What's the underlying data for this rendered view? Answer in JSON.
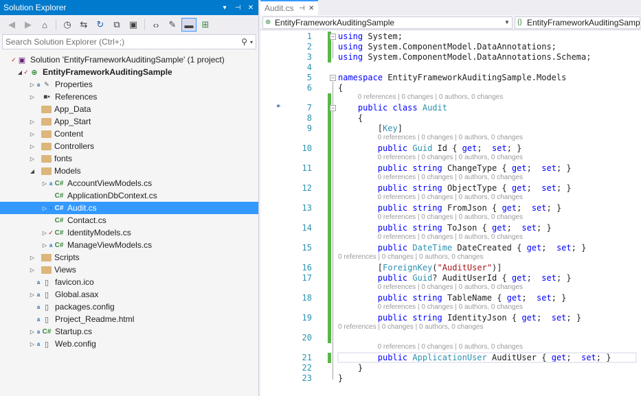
{
  "solution_explorer": {
    "title": "Solution Explorer",
    "title_buttons": [
      "▾",
      "⊣",
      "✕"
    ],
    "search_placeholder": "Search Solution Explorer (Ctrl+;)",
    "tree": [
      {
        "label": "Solution 'EntityFrameworkAuditingSample' (1 project)",
        "indent": 0,
        "arrow": "",
        "state": "check",
        "icon": "sln",
        "bold": false,
        "selected": false
      },
      {
        "label": "EntityFrameworkAuditingSample",
        "indent": 1,
        "arrow": "▲",
        "state": "check",
        "icon": "globe",
        "bold": true,
        "selected": false
      },
      {
        "label": "Properties",
        "indent": 2,
        "arrow": "▷",
        "state": "lock",
        "icon": "wrench",
        "bold": false,
        "selected": false
      },
      {
        "label": "References",
        "indent": 2,
        "arrow": "▷",
        "state": "",
        "icon": "ref",
        "bold": false,
        "selected": false
      },
      {
        "label": "App_Data",
        "indent": 2,
        "arrow": "",
        "state": "",
        "icon": "folder",
        "bold": false,
        "selected": false
      },
      {
        "label": "App_Start",
        "indent": 2,
        "arrow": "▷",
        "state": "",
        "icon": "folder",
        "bold": false,
        "selected": false
      },
      {
        "label": "Content",
        "indent": 2,
        "arrow": "▷",
        "state": "",
        "icon": "folder",
        "bold": false,
        "selected": false
      },
      {
        "label": "Controllers",
        "indent": 2,
        "arrow": "▷",
        "state": "",
        "icon": "folder",
        "bold": false,
        "selected": false
      },
      {
        "label": "fonts",
        "indent": 2,
        "arrow": "▷",
        "state": "",
        "icon": "folder",
        "bold": false,
        "selected": false
      },
      {
        "label": "Models",
        "indent": 2,
        "arrow": "▲",
        "state": "",
        "icon": "folder",
        "bold": false,
        "selected": false
      },
      {
        "label": "AccountViewModels.cs",
        "indent": 3,
        "arrow": "▷",
        "state": "lock",
        "icon": "cs",
        "bold": false,
        "selected": false
      },
      {
        "label": "ApplicationDbContext.cs",
        "indent": 3,
        "arrow": "",
        "state": "",
        "icon": "cs",
        "bold": false,
        "selected": false
      },
      {
        "label": "Audit.cs",
        "indent": 3,
        "arrow": "▷",
        "state": "plus",
        "icon": "cs",
        "bold": false,
        "selected": true
      },
      {
        "label": "Contact.cs",
        "indent": 3,
        "arrow": "",
        "state": "",
        "icon": "cs",
        "bold": false,
        "selected": false
      },
      {
        "label": "IdentityModels.cs",
        "indent": 3,
        "arrow": "▷",
        "state": "check",
        "icon": "cs",
        "bold": false,
        "selected": false
      },
      {
        "label": "ManageViewModels.cs",
        "indent": 3,
        "arrow": "▷",
        "state": "lock",
        "icon": "cs",
        "bold": false,
        "selected": false
      },
      {
        "label": "Scripts",
        "indent": 2,
        "arrow": "▷",
        "state": "",
        "icon": "folder",
        "bold": false,
        "selected": false
      },
      {
        "label": "Views",
        "indent": 2,
        "arrow": "▷",
        "state": "",
        "icon": "folder",
        "bold": false,
        "selected": false
      },
      {
        "label": "favicon.ico",
        "indent": 2,
        "arrow": "",
        "state": "lock",
        "icon": "file",
        "bold": false,
        "selected": false
      },
      {
        "label": "Global.asax",
        "indent": 2,
        "arrow": "▷",
        "state": "lock",
        "icon": "file",
        "bold": false,
        "selected": false
      },
      {
        "label": "packages.config",
        "indent": 2,
        "arrow": "",
        "state": "lock",
        "icon": "file",
        "bold": false,
        "selected": false
      },
      {
        "label": "Project_Readme.html",
        "indent": 2,
        "arrow": "",
        "state": "lock",
        "icon": "file",
        "bold": false,
        "selected": false
      },
      {
        "label": "Startup.cs",
        "indent": 2,
        "arrow": "▷",
        "state": "lock",
        "icon": "cs",
        "bold": false,
        "selected": false
      },
      {
        "label": "Web.config",
        "indent": 2,
        "arrow": "▷",
        "state": "lock",
        "icon": "file",
        "bold": false,
        "selected": false
      }
    ]
  },
  "editor": {
    "tab": {
      "label": "Audit.cs",
      "pin": "⊣",
      "close": "✕"
    },
    "nav": {
      "project": "EntityFrameworkAuditingSample",
      "type": "EntityFrameworkAuditingSample"
    },
    "lines": [
      {
        "n": "1",
        "lens": "",
        "tokens": [
          [
            "kw",
            "using"
          ],
          [
            "",
            "System;"
          ]
        ]
      },
      {
        "n": "2",
        "lens": "",
        "tokens": [
          [
            "kw",
            "using"
          ],
          [
            "",
            "System.ComponentModel.DataAnnotations;"
          ]
        ]
      },
      {
        "n": "3",
        "lens": "",
        "tokens": [
          [
            "kw",
            "using"
          ],
          [
            "",
            "System.ComponentModel.DataAnnotations.Schema;"
          ]
        ]
      },
      {
        "n": "4",
        "lens": "",
        "tokens": []
      },
      {
        "n": "5",
        "lens": "",
        "tokens": [
          [
            "kw",
            "namespace"
          ],
          [
            "",
            "EntityFrameworkAuditingSample.Models"
          ]
        ]
      },
      {
        "n": "6",
        "lens": "",
        "tokens": [
          [
            "",
            "{"
          ]
        ]
      },
      {
        "n": "7",
        "lens": "0 references | 0 changes | 0 authors, 0 changes",
        "tokens": [
          [
            "",
            "    "
          ],
          [
            "kw",
            "public class"
          ],
          [
            "ty",
            "Audit"
          ]
        ]
      },
      {
        "n": "8",
        "lens": "",
        "tokens": [
          [
            "",
            "    {"
          ]
        ]
      },
      {
        "n": "9",
        "lens": "",
        "tokens": [
          [
            "",
            "        ["
          ],
          [
            "ty",
            "Key"
          ],
          [
            "",
            "]"
          ]
        ]
      },
      {
        "n": "10",
        "lens": "0 references | 0 changes | 0 authors, 0 changes",
        "tokens": [
          [
            "",
            "        "
          ],
          [
            "kw",
            "public"
          ],
          [
            "ty",
            "Guid"
          ],
          [
            "",
            "Id {"
          ],
          [
            "kw",
            "get"
          ],
          [
            "",
            "; "
          ],
          [
            "kw",
            "set"
          ],
          [
            "",
            "; }"
          ]
        ]
      },
      {
        "n": "11",
        "lens": "0 references | 0 changes | 0 authors, 0 changes",
        "tokens": [
          [
            "",
            "        "
          ],
          [
            "kw",
            "public string"
          ],
          [
            "",
            "ChangeType {"
          ],
          [
            "kw",
            "get"
          ],
          [
            "",
            "; "
          ],
          [
            "kw",
            "set"
          ],
          [
            "",
            "; }"
          ]
        ]
      },
      {
        "n": "12",
        "lens": "0 references | 0 changes | 0 authors, 0 changes",
        "tokens": [
          [
            "",
            "        "
          ],
          [
            "kw",
            "public string"
          ],
          [
            "",
            "ObjectType {"
          ],
          [
            "kw",
            "get"
          ],
          [
            "",
            "; "
          ],
          [
            "kw",
            "set"
          ],
          [
            "",
            "; }"
          ]
        ]
      },
      {
        "n": "13",
        "lens": "0 references | 0 changes | 0 authors, 0 changes",
        "tokens": [
          [
            "",
            "        "
          ],
          [
            "kw",
            "public string"
          ],
          [
            "",
            "FromJson {"
          ],
          [
            "kw",
            "get"
          ],
          [
            "",
            "; "
          ],
          [
            "kw",
            "set"
          ],
          [
            "",
            "; }"
          ]
        ]
      },
      {
        "n": "14",
        "lens": "0 references | 0 changes | 0 authors, 0 changes",
        "tokens": [
          [
            "",
            "        "
          ],
          [
            "kw",
            "public string"
          ],
          [
            "",
            "ToJson {"
          ],
          [
            "kw",
            "get"
          ],
          [
            "",
            "; "
          ],
          [
            "kw",
            "set"
          ],
          [
            "",
            "; }"
          ]
        ]
      },
      {
        "n": "15",
        "lens": "0 references | 0 changes | 0 authors, 0 changes",
        "tokens": [
          [
            "",
            "        "
          ],
          [
            "kw",
            "public"
          ],
          [
            "ty",
            "DateTime"
          ],
          [
            "",
            "DateCreated {"
          ],
          [
            "kw",
            "get"
          ],
          [
            "",
            "; "
          ],
          [
            "kw",
            "set"
          ],
          [
            "",
            "; }"
          ]
        ]
      },
      {
        "n": "16",
        "lens": "0 references | 0 changes | 0 authors, 0 changes",
        "tokens": [
          [
            "",
            "        ["
          ],
          [
            "ty",
            "ForeignKey"
          ],
          [
            "",
            "("
          ],
          [
            "st",
            "\"AuditUser\""
          ],
          [
            "",
            ")]"
          ]
        ]
      },
      {
        "n": "17",
        "lens": "",
        "tokens": [
          [
            "",
            "        "
          ],
          [
            "kw",
            "public"
          ],
          [
            "ty",
            "Guid"
          ],
          [
            "",
            "? AuditUserId {"
          ],
          [
            "kw",
            "get"
          ],
          [
            "",
            "; "
          ],
          [
            "kw",
            "set"
          ],
          [
            "",
            "; }"
          ]
        ]
      },
      {
        "n": "18",
        "lens": "0 references | 0 changes | 0 authors, 0 changes",
        "tokens": [
          [
            "",
            "        "
          ],
          [
            "kw",
            "public string"
          ],
          [
            "",
            "TableName {"
          ],
          [
            "kw",
            "get"
          ],
          [
            "",
            "; "
          ],
          [
            "kw",
            "set"
          ],
          [
            "",
            "; }"
          ]
        ]
      },
      {
        "n": "19",
        "lens": "0 references | 0 changes | 0 authors, 0 changes",
        "tokens": [
          [
            "",
            "        "
          ],
          [
            "kw",
            "public string"
          ],
          [
            "",
            "IdentityJson {"
          ],
          [
            "kw",
            "get"
          ],
          [
            "",
            "; "
          ],
          [
            "kw",
            "set"
          ],
          [
            "",
            "; }"
          ]
        ]
      },
      {
        "n": "20",
        "lens": "0 references | 0 changes | 0 authors, 0 changes",
        "tokens": []
      },
      {
        "n": "21",
        "lens": "0 references | 0 changes | 0 authors, 0 changes",
        "tokens": [
          [
            "",
            "        "
          ],
          [
            "kw",
            "public"
          ],
          [
            "ty",
            "ApplicationUser"
          ],
          [
            "",
            "AuditUser {"
          ],
          [
            "kw",
            "get"
          ],
          [
            "",
            "; "
          ],
          [
            "kw",
            "set"
          ],
          [
            "",
            "; }"
          ]
        ]
      },
      {
        "n": "22",
        "lens": "",
        "tokens": [
          [
            "",
            "    }"
          ]
        ]
      },
      {
        "n": "23",
        "lens": "",
        "tokens": [
          [
            "",
            "}"
          ]
        ]
      }
    ]
  },
  "colors": {
    "accent": "#007acc",
    "selection": "#3399ff",
    "keyword": "#0000ff",
    "type": "#2b91af",
    "string": "#a31515",
    "change_bar": "#57b845",
    "line_number": "#2b91af"
  },
  "icons": [
    "back-icon",
    "forward-icon",
    "home-icon",
    "history-icon",
    "sync-icon",
    "refresh-icon",
    "collapse-all-icon",
    "show-all-files-icon",
    "view-code-icon",
    "properties-icon",
    "preview-icon",
    "class-diagram-icon",
    "search-icon",
    "pin-icon",
    "close-icon"
  ]
}
